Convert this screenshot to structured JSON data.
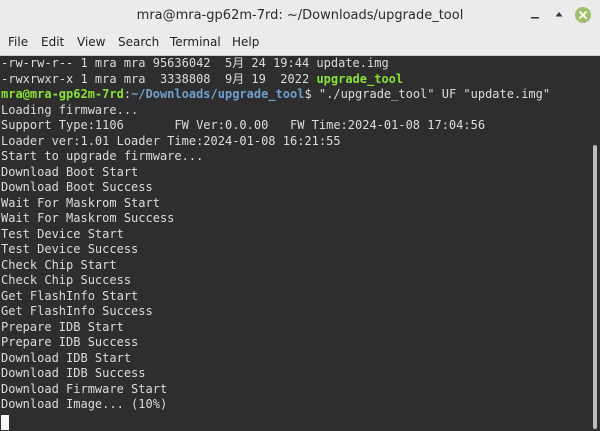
{
  "window": {
    "title": "mra@mra-gp62m-7rd: ~/Downloads/upgrade_tool"
  },
  "menu": [
    "File",
    "Edit",
    "View",
    "Search",
    "Terminal",
    "Help"
  ],
  "terminal": {
    "ls1": "-rw-rw-r-- 1 mra mra 95636042  5月 24 19:44 update.img",
    "ls2_prefix": "-rwxrwxr-x 1 mra mra  3338808  9月 19  2022 ",
    "ls2_name": "upgrade_tool",
    "prompt_user": "mra@mra-gp62m-7rd",
    "prompt_colon": ":",
    "prompt_path": "~/Downloads/upgrade_tool",
    "prompt_command": "$ \"./upgrade_tool\" UF \"update.img\"",
    "output": [
      "Loading firmware...",
      "Support Type:1106       FW Ver:0.0.00   FW Time:2024-01-08 17:04:56",
      "Loader ver:1.01 Loader Time:2024-01-08 16:21:55",
      "Start to upgrade firmware...",
      "Download Boot Start",
      "Download Boot Success",
      "Wait For Maskrom Start",
      "Wait For Maskrom Success",
      "Test Device Start",
      "Test Device Success",
      "Check Chip Start",
      "Check Chip Success",
      "Get FlashInfo Start",
      "Get FlashInfo Success",
      "Prepare IDB Start",
      "Prepare IDB Success",
      "Download IDB Start",
      "Download IDB Success",
      "Download Firmware Start",
      "Download Image... (10%)"
    ]
  },
  "colors": {
    "terminal_bg": "#2e2e2e",
    "terminal_fg": "#dcdcdc",
    "prompt_user": "#8ae234",
    "prompt_path": "#729fcf",
    "titlebar_bg": "#ebebeb",
    "close_button": "#9fbf6b"
  },
  "icons": {
    "minimize": "minimize-icon",
    "maximize": "maximize-icon",
    "close": "close-icon"
  }
}
